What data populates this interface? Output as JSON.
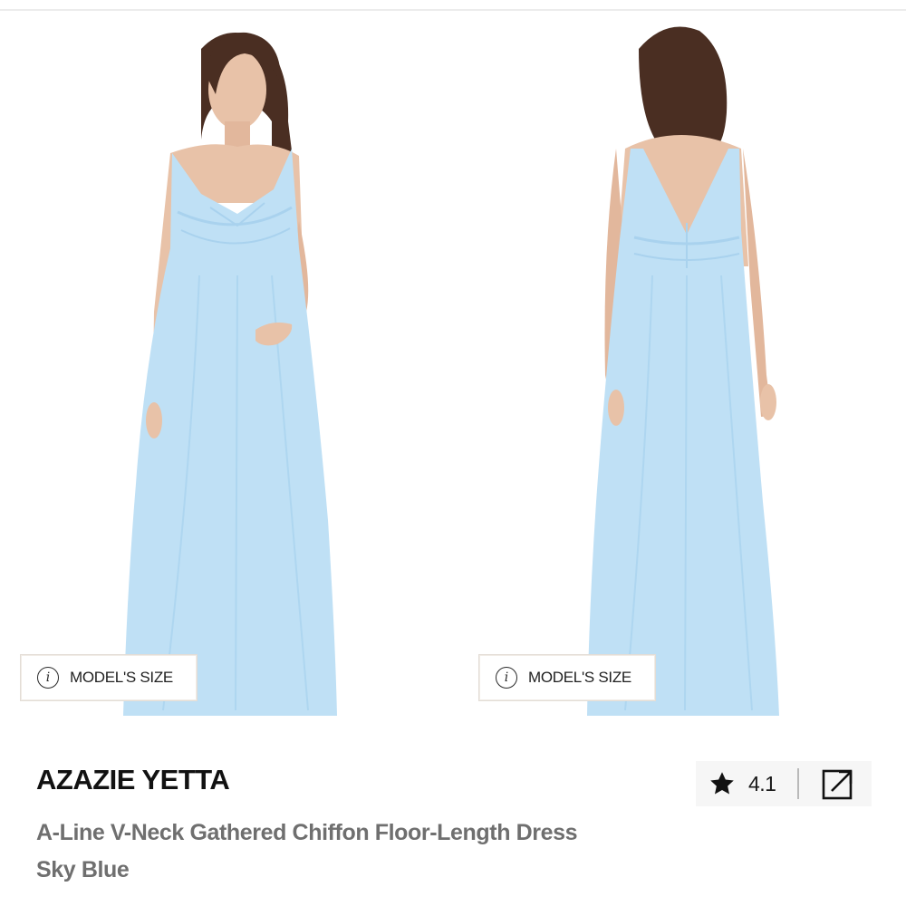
{
  "gallery": {
    "images": [
      {
        "name": "front-view",
        "model_size_label": "MODEL'S SIZE"
      },
      {
        "name": "back-view",
        "model_size_label": "MODEL'S SIZE"
      }
    ]
  },
  "product": {
    "brand": "AZAZIE YETTA",
    "name": "A-Line V-Neck Gathered Chiffon Floor-Length Dress",
    "color": "Sky Blue"
  },
  "rating": {
    "value": "4.1",
    "icon": "star-icon"
  },
  "actions": {
    "share_icon": "external-link-icon"
  },
  "colors": {
    "dress": "#bfe0f5",
    "dress_shadow": "#a9d2ee",
    "skin": "#e8c2a8",
    "hair": "#4a2e22",
    "text_primary": "#111111",
    "text_secondary": "#6f6f6f",
    "rating_bg": "#f6f6f6"
  }
}
